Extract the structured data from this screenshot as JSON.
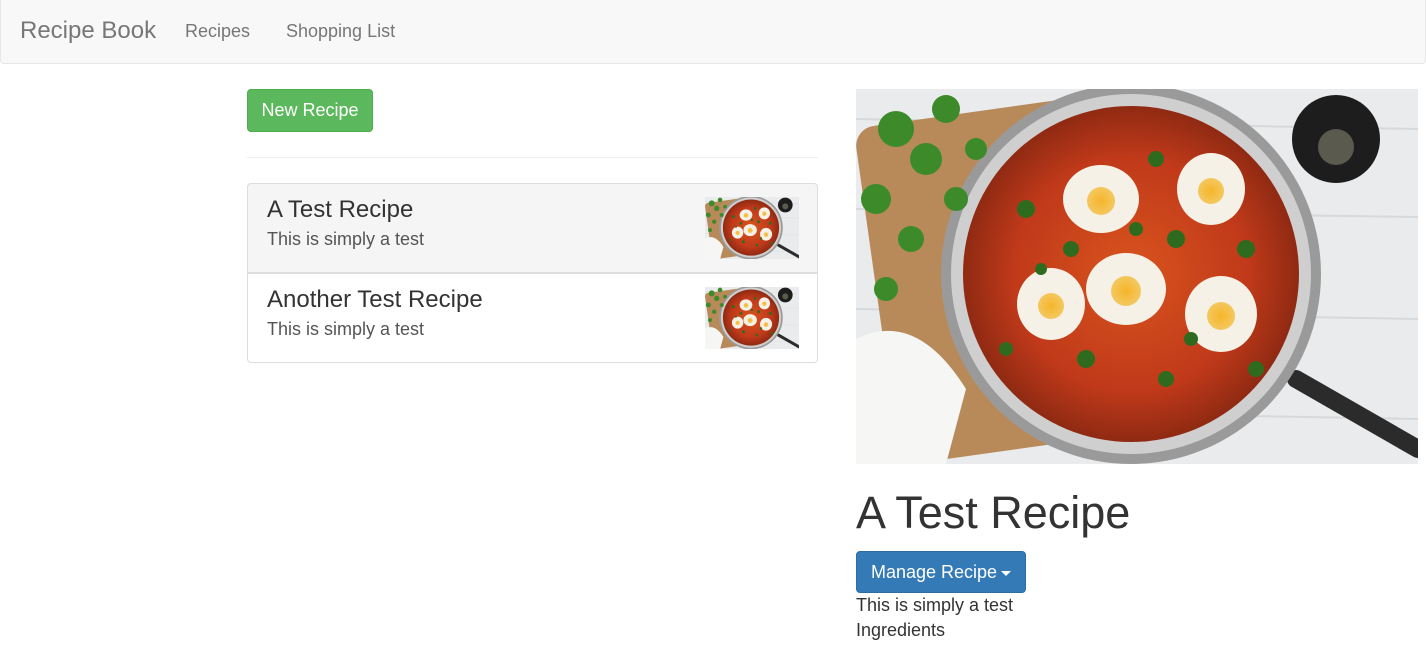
{
  "navbar": {
    "brand": "Recipe Book",
    "links": [
      "Recipes",
      "Shopping List"
    ]
  },
  "recipe_list": {
    "new_button_label": "New Recipe",
    "items": [
      {
        "name": "A Test Recipe",
        "description": "This is simply a test",
        "active": true
      },
      {
        "name": "Another Test Recipe",
        "description": "This is simply a test",
        "active": false
      }
    ]
  },
  "detail": {
    "name": "A Test Recipe",
    "manage_button_label": "Manage Recipe",
    "description": "This is simply a test",
    "ingredients_heading": "Ingredients"
  },
  "colors": {
    "success": "#5cb85c",
    "primary": "#337ab7",
    "navbar_bg": "#f8f8f8",
    "nav_text": "#777777"
  },
  "icons": [
    "caret-down-icon"
  ]
}
